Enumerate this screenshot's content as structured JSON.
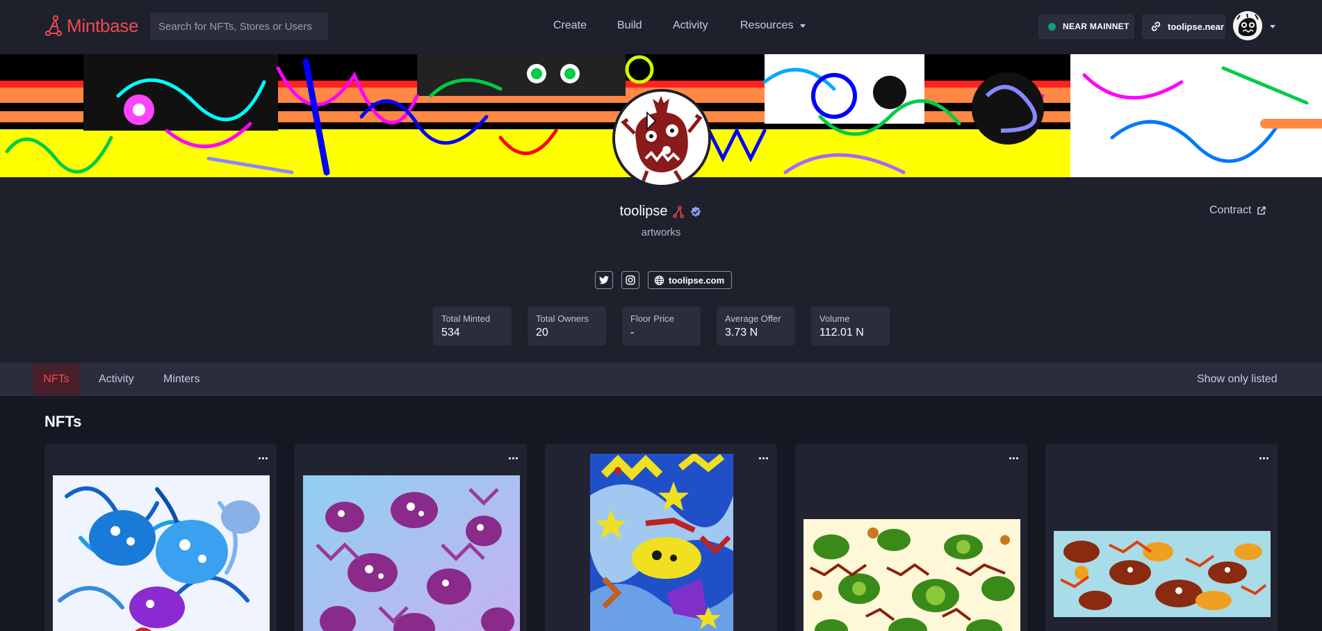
{
  "header": {
    "logo_text": "Mintbase",
    "search_placeholder": "Search for NFTs, Stores or Users",
    "nav": {
      "create": "Create",
      "build": "Build",
      "activity": "Activity",
      "resources": "Resources"
    },
    "network": "NEAR MAINNET",
    "account": "toolipse.near",
    "accent_color": "#f04a55"
  },
  "profile": {
    "name": "toolipse",
    "subtitle": "artworks",
    "contract_label": "Contract",
    "website": "toolipse.com",
    "stats": [
      {
        "label": "Total Minted",
        "value": "534"
      },
      {
        "label": "Total Owners",
        "value": "20"
      },
      {
        "label": "Floor Price",
        "value": "-"
      },
      {
        "label": "Average Offer",
        "value": "3.73 N"
      },
      {
        "label": "Volume",
        "value": "112.01 N"
      }
    ]
  },
  "tabs": {
    "nfts": "NFTs",
    "activity": "Activity",
    "minters": "Minters",
    "show_only_listed": "Show only listed"
  },
  "nfts_section": {
    "title": "NFTs"
  }
}
